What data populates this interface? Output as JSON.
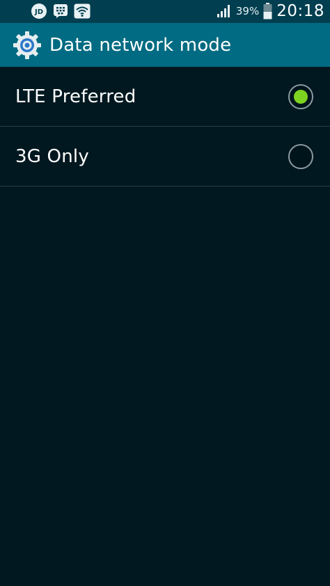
{
  "status_bar": {
    "notification_icons": [
      "jd-app-icon",
      "bbm-icon",
      "wifi-icon"
    ],
    "jd_label": "JD",
    "battery_percent": "39%",
    "time": "20:18"
  },
  "action_bar": {
    "icon": "settings-gear-icon",
    "title": "Data network mode"
  },
  "options": [
    {
      "label": "LTE Preferred",
      "selected": true
    },
    {
      "label": "3G Only",
      "selected": false
    }
  ],
  "colors": {
    "status_bar_bg": "#003e50",
    "action_bar_bg": "#006b82",
    "background": "#011820",
    "radio_selected": "#7ed321",
    "divider": "#27424b"
  }
}
